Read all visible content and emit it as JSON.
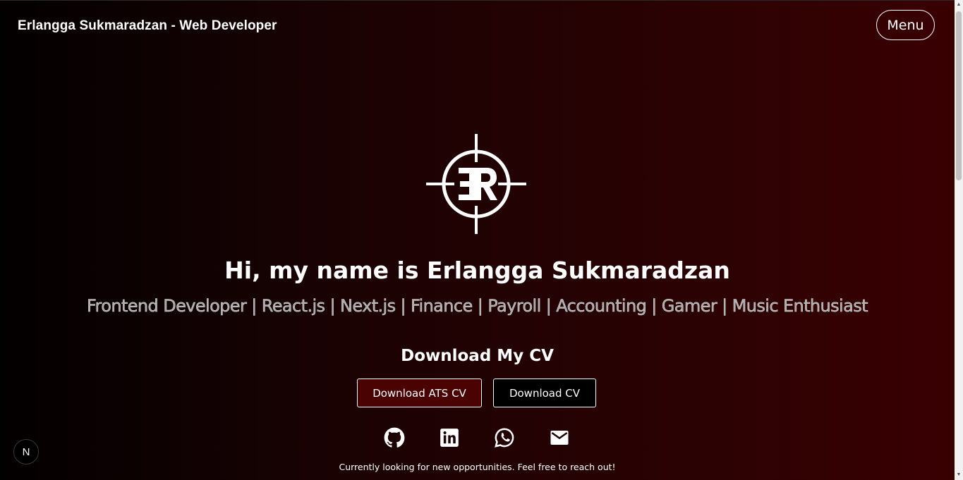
{
  "header": {
    "title": "Erlangga Sukmaradzan - Web Developer",
    "menu_label": "Menu"
  },
  "hero": {
    "logo_icon": "er-crosshair-logo-icon",
    "logo_text": "ER",
    "headline": "Hi, my name is Erlangga Sukmaradzan",
    "subtitle": "Frontend Developer | React.js | Next.js | Finance | Payroll | Accounting | Gamer | Music Enthusiast"
  },
  "cv": {
    "heading": "Download My CV",
    "ats_button": "Download ATS CV",
    "cv_button": "Download CV"
  },
  "social": [
    {
      "icon": "github-icon"
    },
    {
      "icon": "linkedin-icon"
    },
    {
      "icon": "whatsapp-icon"
    },
    {
      "icon": "email-icon"
    }
  ],
  "footer": {
    "note": "Currently looking for new opportunities. Feel free to reach out!"
  },
  "badge": {
    "label": "N"
  },
  "colors": {
    "background_start": "#030000",
    "background_end": "#3a0002",
    "ats_button_bg": "#4a0202",
    "cv_button_bg": "#000000",
    "subtitle_text": "#a8a8a8"
  }
}
